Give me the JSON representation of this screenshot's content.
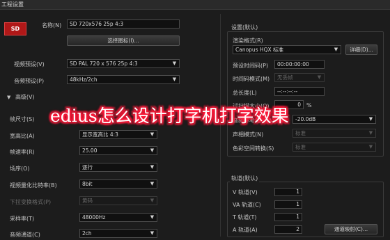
{
  "window": {
    "title": "工程设置"
  },
  "badge": {
    "text": "SD"
  },
  "left": {
    "name_label": "名称(N)",
    "name_value": "SD 720x576 25p 4:3",
    "select_preset_button": "选择图标(I)...",
    "video_preset_label": "视频预设(V)",
    "video_preset_value": "SD PAL 720 x 576 25p 4:3",
    "audio_preset_label": "音频预设(P)",
    "audio_preset_value": "48kHz/2ch",
    "advanced_label": "高级(V)",
    "rows": [
      {
        "label": "帧尺寸(S)",
        "value": "",
        "dim": false,
        "type": "none"
      },
      {
        "label": "宽高比(A)",
        "value": "显示宽高比 4:3",
        "dim": false,
        "type": "select"
      },
      {
        "label": "帧速率(R)",
        "value": "25.00",
        "dim": false,
        "type": "select"
      },
      {
        "label": "场序(O)",
        "value": "逐行",
        "dim": false,
        "type": "select"
      },
      {
        "label": "视频量化比特率(B)",
        "value": "8bit",
        "dim": false,
        "type": "select"
      },
      {
        "label": "下拉变换格式(P)",
        "value": "黄码",
        "dim": true,
        "type": "select"
      },
      {
        "label": "采样率(T)",
        "value": "48000Hz",
        "dim": false,
        "type": "select"
      },
      {
        "label": "音频通道(C)",
        "value": "2ch",
        "dim": false,
        "type": "select"
      }
    ]
  },
  "settings_group": {
    "title": "设置(默认)",
    "render_format_label": "渲染格式(R)",
    "render_format_value": "Canopus HQX 标准",
    "details_button": "详细(D)...",
    "preset_timecode_label": "预设时间码(P)",
    "preset_timecode_value": "00:00:00:00",
    "timecode_mode_label": "时间码模式(M)",
    "timecode_mode_value": "无丢帧",
    "total_length_label": "总长度(L)",
    "total_length_value": "--:--:--:--",
    "overscan_label": "过扫描大小(O)",
    "overscan_value": "0",
    "overscan_unit": "%",
    "audio_ref_label": "音频参考电平(A)",
    "audio_ref_value": "-20.0dB",
    "channel_mode_label": "声相模式(N)",
    "channel_mode_value": "标准",
    "color_space_label": "色彩空间转换(S)",
    "color_space_value": "标准"
  },
  "tracks_group": {
    "title": "轨道(默认)",
    "rows": [
      {
        "label": "V 轨道(V)",
        "value": "1"
      },
      {
        "label": "VA 轨道(C)",
        "value": "1"
      },
      {
        "label": "T 轨道(T)",
        "value": "1"
      },
      {
        "label": "A 轨道(A)",
        "value": "2"
      }
    ],
    "channel_map_button": "通道映射(C)..."
  },
  "overlay": {
    "text": "edius怎么设计打字机打字效果",
    "color": "#ff1a3a"
  }
}
